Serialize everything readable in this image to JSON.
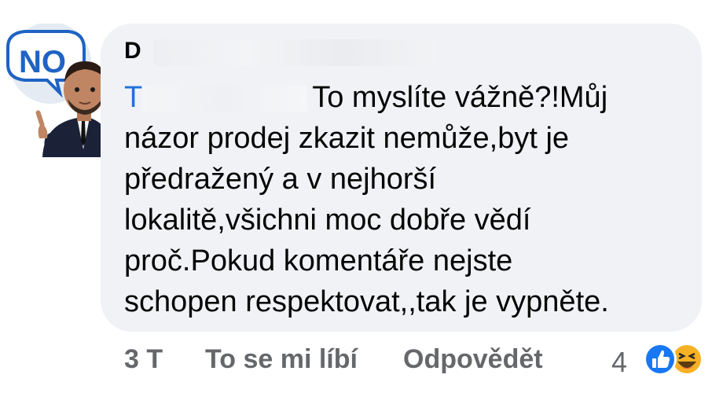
{
  "comment": {
    "author_initial": "D",
    "mention_initial": "T",
    "text_line1": "To myslíte vážně?!Můj",
    "text_line2": "názor prodej zkazit nemůže,byt je",
    "text_line3": "předražený a v nejhorší",
    "text_line4": "lokalitě,všichni moc dobře vědí",
    "text_line5": "proč.Pokud komentáře nejste",
    "text_line6": "schopen respektovat,,tak je vypněte."
  },
  "avatar": {
    "bubble_text": "NO",
    "icon": "memoji-no-avatar"
  },
  "actions": {
    "time": "3 T",
    "like_label": "To se mi líbí",
    "reply_label": "Odpovědět"
  },
  "reactions": {
    "count": "4",
    "icons": [
      "like-reaction-icon",
      "haha-reaction-icon"
    ]
  },
  "colors": {
    "bubble": "#f0f2f5",
    "mention": "#216fdb",
    "meta": "#65676b",
    "like_blue": "#1877f2"
  }
}
